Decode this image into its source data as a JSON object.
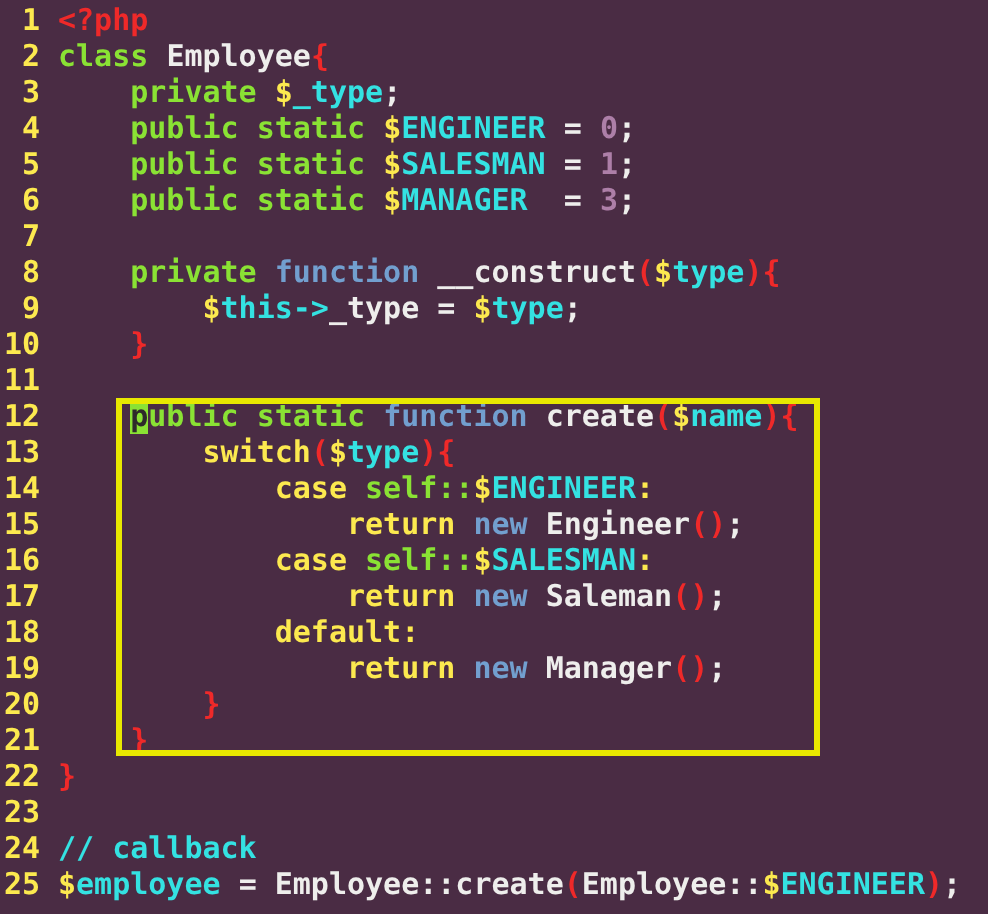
{
  "editor": {
    "blocks": [
      {
        "highlighted": false,
        "lines": [
          {
            "number": "1",
            "tokens": [
              {
                "kind": "tag",
                "text": "<?php"
              }
            ]
          },
          {
            "number": "2",
            "tokens": [
              {
                "kind": "kw",
                "text": "class"
              },
              {
                "kind": "plain",
                "text": " Employee"
              },
              {
                "kind": "paren",
                "text": "{"
              }
            ]
          },
          {
            "number": "3",
            "tokens": [
              {
                "kind": "kw",
                "text": "    private "
              },
              {
                "kind": "var",
                "text": "$_type"
              },
              {
                "kind": "plain",
                "text": ";"
              }
            ]
          },
          {
            "number": "4",
            "tokens": [
              {
                "kind": "kw",
                "text": "    public static "
              },
              {
                "kind": "var",
                "text": "$ENGINEER"
              },
              {
                "kind": "plain",
                "text": " = "
              },
              {
                "kind": "num",
                "text": "0"
              },
              {
                "kind": "plain",
                "text": ";"
              }
            ]
          },
          {
            "number": "5",
            "tokens": [
              {
                "kind": "kw",
                "text": "    public static "
              },
              {
                "kind": "var",
                "text": "$SALESMAN"
              },
              {
                "kind": "plain",
                "text": " = "
              },
              {
                "kind": "num",
                "text": "1"
              },
              {
                "kind": "plain",
                "text": ";"
              }
            ]
          },
          {
            "number": "6",
            "tokens": [
              {
                "kind": "kw",
                "text": "    public static "
              },
              {
                "kind": "var",
                "text": "$MANAGER"
              },
              {
                "kind": "plain",
                "text": "  = "
              },
              {
                "kind": "num",
                "text": "3"
              },
              {
                "kind": "plain",
                "text": ";"
              }
            ]
          },
          {
            "number": "7"
          },
          {
            "number": "8",
            "tokens": [
              {
                "kind": "kw",
                "text": "    private "
              },
              {
                "kind": "fn",
                "text": "function"
              },
              {
                "kind": "plain",
                "text": " __construct"
              },
              {
                "kind": "paren",
                "text": "("
              },
              {
                "kind": "var",
                "text": "$type"
              },
              {
                "kind": "paren",
                "text": "){"
              }
            ]
          },
          {
            "number": "9",
            "tokens": [
              {
                "kind": "var",
                "text": "        $this->"
              },
              {
                "kind": "plain",
                "text": "_type = "
              },
              {
                "kind": "var",
                "text": "$type"
              },
              {
                "kind": "plain",
                "text": ";"
              }
            ]
          },
          {
            "number": "10",
            "tokens": [
              {
                "kind": "paren",
                "text": "    }"
              }
            ]
          },
          {
            "number": "11"
          }
        ]
      },
      {
        "highlighted": true,
        "lines": [
          {
            "number": "12",
            "tokens": [
              {
                "kind": "cursor",
                "text": "    p"
              },
              {
                "kind": "kw",
                "text": "ublic static "
              },
              {
                "kind": "fn",
                "text": "function"
              },
              {
                "kind": "plain",
                "text": " create"
              },
              {
                "kind": "paren",
                "text": "("
              },
              {
                "kind": "var",
                "text": "$name"
              },
              {
                "kind": "paren",
                "text": "){"
              }
            ]
          },
          {
            "number": "13",
            "tokens": [
              {
                "kind": "ctrl",
                "text": "        switch"
              },
              {
                "kind": "paren",
                "text": "("
              },
              {
                "kind": "var",
                "text": "$type"
              },
              {
                "kind": "paren",
                "text": "){"
              }
            ]
          },
          {
            "number": "14",
            "tokens": [
              {
                "kind": "ctrl",
                "text": "            case "
              },
              {
                "kind": "kw",
                "text": "self::"
              },
              {
                "kind": "var",
                "text": "$ENGINEER"
              },
              {
                "kind": "ctrl",
                "text": ":"
              }
            ]
          },
          {
            "number": "15",
            "tokens": [
              {
                "kind": "ctrl",
                "text": "                return "
              },
              {
                "kind": "fn",
                "text": "new"
              },
              {
                "kind": "plain",
                "text": " Engineer"
              },
              {
                "kind": "paren",
                "text": "()"
              },
              {
                "kind": "plain",
                "text": ";"
              }
            ]
          },
          {
            "number": "16",
            "tokens": [
              {
                "kind": "ctrl",
                "text": "            case "
              },
              {
                "kind": "kw",
                "text": "self::"
              },
              {
                "kind": "var",
                "text": "$SALESMAN"
              },
              {
                "kind": "ctrl",
                "text": ":"
              }
            ]
          },
          {
            "number": "17",
            "tokens": [
              {
                "kind": "ctrl",
                "text": "                return "
              },
              {
                "kind": "fn",
                "text": "new"
              },
              {
                "kind": "plain",
                "text": " Saleman"
              },
              {
                "kind": "paren",
                "text": "()"
              },
              {
                "kind": "plain",
                "text": ";"
              }
            ]
          },
          {
            "number": "18",
            "tokens": [
              {
                "kind": "ctrl",
                "text": "            default:"
              }
            ]
          },
          {
            "number": "19",
            "tokens": [
              {
                "kind": "ctrl",
                "text": "                return "
              },
              {
                "kind": "fn",
                "text": "new"
              },
              {
                "kind": "plain",
                "text": " Manager"
              },
              {
                "kind": "paren",
                "text": "()"
              },
              {
                "kind": "plain",
                "text": ";"
              }
            ]
          },
          {
            "number": "20",
            "tokens": [
              {
                "kind": "paren",
                "text": "        }"
              }
            ]
          },
          {
            "number": "21",
            "tokens": [
              {
                "kind": "paren",
                "text": "    }"
              }
            ]
          }
        ]
      },
      {
        "highlighted": false,
        "lines": [
          {
            "number": "22",
            "tokens": [
              {
                "kind": "paren",
                "text": "}"
              }
            ]
          },
          {
            "number": "23"
          },
          {
            "number": "24",
            "tokens": [
              {
                "kind": "comment",
                "text": "// callback"
              }
            ]
          },
          {
            "number": "25",
            "tokens": [
              {
                "kind": "var",
                "text": "$employee"
              },
              {
                "kind": "plain",
                "text": " = Employee::create"
              },
              {
                "kind": "paren",
                "text": "("
              },
              {
                "kind": "plain",
                "text": "Employee::"
              },
              {
                "kind": "var",
                "text": "$ENGINEER"
              },
              {
                "kind": "paren",
                "text": ")"
              },
              {
                "kind": "plain",
                "text": ";"
              }
            ]
          }
        ]
      }
    ]
  }
}
